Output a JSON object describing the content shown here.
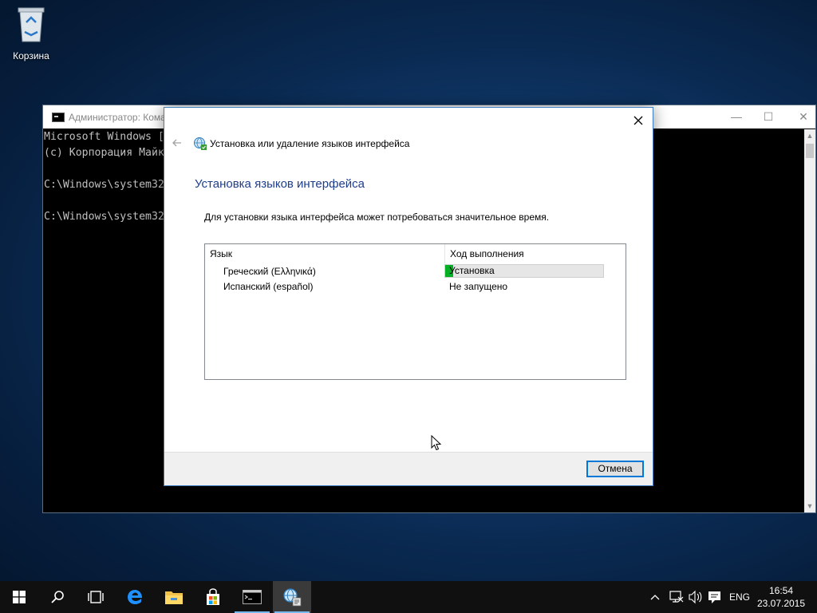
{
  "desktop": {
    "recycle_bin_label": "Корзина"
  },
  "console": {
    "title": "Администратор: Кома",
    "lines": [
      "Microsoft Windows [",
      "(c) Корпорация Майк",
      "",
      "C:\\Windows\\system32",
      "",
      "C:\\Windows\\system32"
    ],
    "minimize": "—",
    "maximize": "☐",
    "close": "✕"
  },
  "dialog": {
    "header_title": "Установка или удаление языков интерфейса",
    "main_title": "Установка языков интерфейса",
    "description": "Для установки языка интерфейса может потребоваться значительное время.",
    "columns": [
      "Язык",
      "Ход выполнения"
    ],
    "rows": [
      {
        "language": "Греческий (Ελληνικά)",
        "status": "Установка",
        "progress": 0.05
      },
      {
        "language": "Испанский (español)",
        "status": "Не запущено"
      }
    ],
    "cancel_label": "Отмена"
  },
  "taskbar": {
    "language": "ENG",
    "time": "16:54",
    "date": "23.07.2015",
    "buttons": [
      "start-icon",
      "search-icon",
      "task-view-icon",
      "edge-icon",
      "file-explorer-icon",
      "store-icon",
      "command-prompt-icon",
      "language-settings-icon"
    ],
    "colors": {
      "accent": "#76b9ed",
      "progress": "#06b025",
      "dialog_title": "#1e3d8a"
    }
  }
}
